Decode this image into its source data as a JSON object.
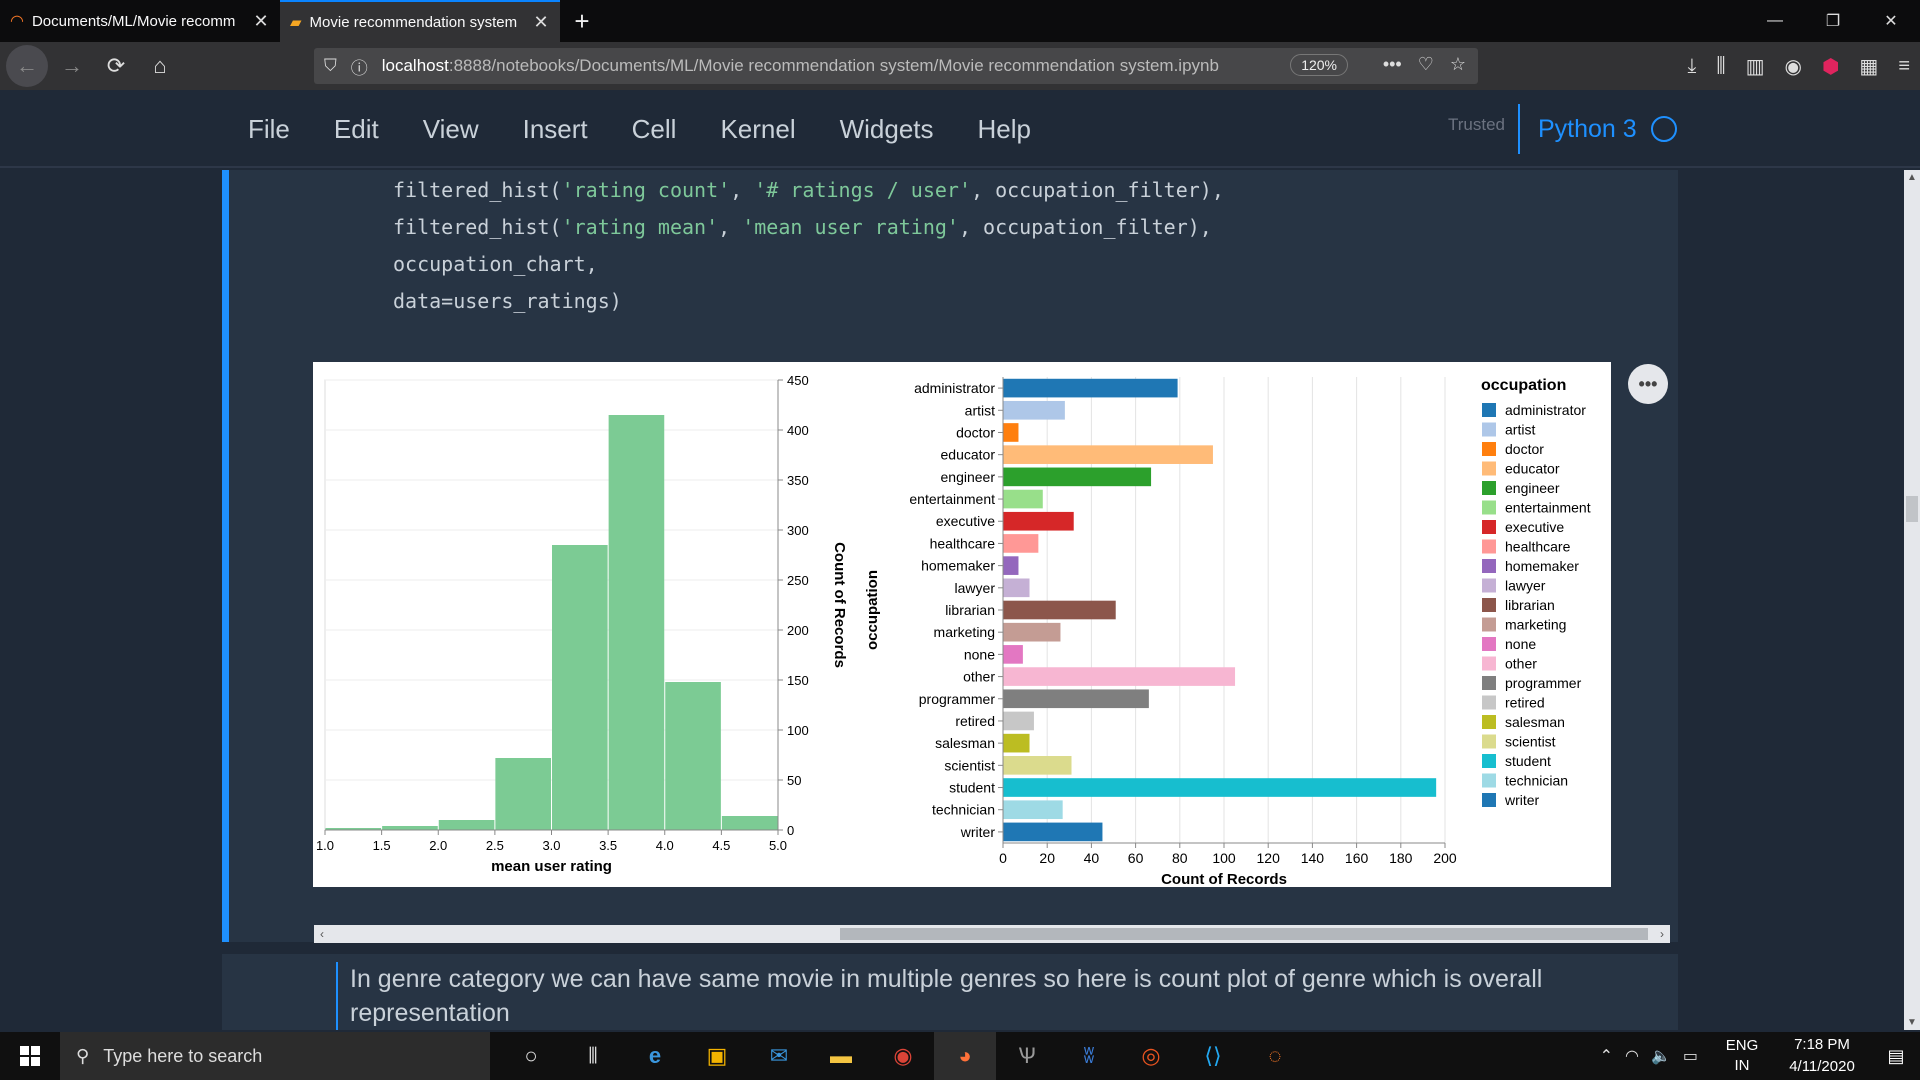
{
  "browser": {
    "tabs": [
      {
        "title": "Documents/ML/Movie recomm",
        "active": false
      },
      {
        "title": "Movie recommendation system",
        "active": true
      }
    ],
    "url_host": "localhost",
    "url_path": ":8888/notebooks/Documents/ML/Movie recommendation system/Movie recommendation system.ipynb",
    "zoom": "120%"
  },
  "jupyter": {
    "menu": [
      "File",
      "Edit",
      "View",
      "Insert",
      "Cell",
      "Kernel",
      "Widgets",
      "Help"
    ],
    "trusted": "Trusted",
    "kernel": "Python 3"
  },
  "code": {
    "line1_a": "filtered_hist(",
    "line1_s1": "'rating count'",
    "line1_b": ", ",
    "line1_s2": "'# ratings / user'",
    "line1_c": ", occupation_filter),",
    "line2_a": "filtered_hist(",
    "line2_s1": "'rating mean'",
    "line2_b": ", ",
    "line2_s2": "'mean user rating'",
    "line2_c": ", occupation_filter),",
    "line3": "occupation_chart,",
    "line4": "data=users_ratings)"
  },
  "markdown": {
    "text": "In genre category we can have same movie in multiple genres so here is count plot of genre which is overall representation"
  },
  "taskbar": {
    "search_placeholder": "Type here to search",
    "lang_top": "ENG",
    "lang_bottom": "IN",
    "time": "7:18 PM",
    "date": "4/11/2020"
  },
  "chart_data": [
    {
      "type": "bar",
      "x": [
        1.0,
        1.5,
        2.0,
        2.5,
        3.0,
        3.5,
        4.0,
        4.5
      ],
      "bin_width": 0.5,
      "values": [
        2,
        4,
        10,
        72,
        285,
        415,
        148,
        14
      ],
      "xlabel": "mean user rating",
      "ylabel": "Count of Records",
      "xlim": [
        1.0,
        5.0
      ],
      "ylim": [
        0,
        450
      ],
      "x_ticks": [
        "1.0",
        "1.5",
        "2.0",
        "2.5",
        "3.0",
        "3.5",
        "4.0",
        "4.5",
        "5.0"
      ],
      "y_ticks": [
        "0",
        "50",
        "100",
        "150",
        "200",
        "250",
        "300",
        "350",
        "400",
        "450"
      ],
      "color": "#7ccb94"
    },
    {
      "type": "bar",
      "orientation": "horizontal",
      "categories": [
        "administrator",
        "artist",
        "doctor",
        "educator",
        "engineer",
        "entertainment",
        "executive",
        "healthcare",
        "homemaker",
        "lawyer",
        "librarian",
        "marketing",
        "none",
        "other",
        "programmer",
        "retired",
        "salesman",
        "scientist",
        "student",
        "technician",
        "writer"
      ],
      "values": [
        79,
        28,
        7,
        95,
        67,
        18,
        32,
        16,
        7,
        12,
        51,
        26,
        9,
        105,
        66,
        14,
        12,
        31,
        196,
        27,
        45
      ],
      "colors": [
        "#1f77b4",
        "#aec7e8",
        "#ff7f0e",
        "#ffbb78",
        "#2ca02c",
        "#98df8a",
        "#d62728",
        "#ff9896",
        "#9467bd",
        "#c5b0d5",
        "#8c564b",
        "#c49c94",
        "#e377c2",
        "#f7b6d2",
        "#7f7f7f",
        "#c7c7c7",
        "#bcbd22",
        "#dbdb8d",
        "#17becf",
        "#9edae5",
        "#1f77b4"
      ],
      "xlabel": "Count of Records",
      "ylabel": "occupation",
      "xlim": [
        0,
        200
      ],
      "x_ticks": [
        "0",
        "20",
        "40",
        "60",
        "80",
        "100",
        "120",
        "140",
        "160",
        "180",
        "200"
      ],
      "legend_title": "occupation",
      "legend_position": "right"
    }
  ]
}
